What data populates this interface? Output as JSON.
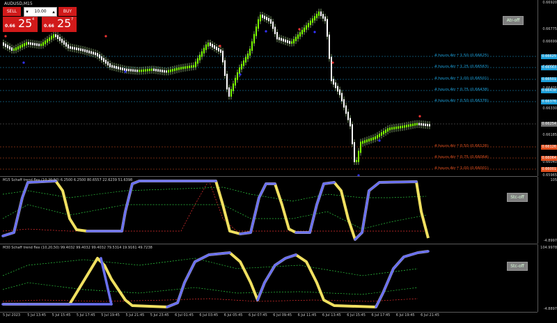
{
  "symbol": "AUDUSD,M15",
  "trade": {
    "sell_label": "SELL",
    "buy_label": "BUY",
    "lot_value": "10.00",
    "minus": "▾",
    "plus": "▴",
    "sell_small": "0.66",
    "sell_big": "25",
    "sell_sup": "4",
    "buy_small": "0.66",
    "buy_big": "25",
    "buy_sup": "7"
  },
  "atr_button": "Atr-off",
  "stc_button_1": "Stc-off",
  "stc_button_2": "Stc-off",
  "price_axis": [
    "0.66920",
    "0.66775",
    "0.66699",
    "0.66550",
    "0.66405",
    "0.66330",
    "0.66185",
    "0.66040",
    "0.65965"
  ],
  "price_levels": [
    {
      "label": "0.66625",
      "color": "#1c9ed8"
    },
    {
      "label": "0.66563",
      "color": "#1c9ed8"
    },
    {
      "label": "0.66501",
      "color": "#1c9ed8"
    },
    {
      "label": "0.66438",
      "color": "#1c9ed8"
    },
    {
      "label": "0.66376",
      "color": "#1c9ed8"
    },
    {
      "label": "0.66254",
      "color": "#6e6e6e"
    },
    {
      "label": "0.66126",
      "color": "#e1501e"
    },
    {
      "label": "0.66064",
      "color": "#e1501e"
    },
    {
      "label": "0.66001",
      "color": "#e1501e"
    }
  ],
  "atr_labels": [
    {
      "text": "4 hours Atr * 1.50 (0.66625)",
      "color": "#1c9ed8"
    },
    {
      "text": "4 hours Atr * 1.25 (0.66563)",
      "color": "#1c9ed8"
    },
    {
      "text": "4 hours Atr * 1.00 (0.66501)",
      "color": "#1c9ed8"
    },
    {
      "text": "4 hours Atr * 0.75 (0.66438)",
      "color": "#1c9ed8"
    },
    {
      "text": "4 hours Atr * 0.50 (0.66376)",
      "color": "#1c9ed8"
    },
    {
      "text": "4 hours Atr * 0.50 (0.66126)",
      "color": "#e1501e"
    },
    {
      "text": "4 hours Atr * 0.75 (0.66064)",
      "color": "#e1501e"
    },
    {
      "text": "4 hours Atr * 1.00 (0.66001)",
      "color": "#e1501e"
    }
  ],
  "pane2": {
    "title": "M15 Schaff trend flex (10,20,50) 6.2500 6.2500 80.6557 22.6239 51.6398",
    "axis_top": "105",
    "axis_bottom": "-4.8997"
  },
  "pane3": {
    "title": "M30 Schaff trend flex (10,20,50) 99.4032 99.4032 99.4032 79.5314 19.9161 49.7238",
    "axis_top": "104.9978",
    "axis_bottom": "-4.8897"
  },
  "time_axis": [
    "5 Jul 2023",
    "5 Jul 13:45",
    "5 Jul 15:45",
    "5 Jul 17:45",
    "5 Jul 19:45",
    "5 Jul 21:45",
    "5 Jul 23:45",
    "6 Jul 01:45",
    "6 Jul 03:45",
    "6 Jul 05:45",
    "6 Jul 07:45",
    "6 Jul 09:45",
    "6 Jul 11:45",
    "6 Jul 13:45",
    "6 Jul 15:45",
    "6 Jul 17:45",
    "6 Jul 19:45",
    "6 Jul 21:45"
  ]
}
